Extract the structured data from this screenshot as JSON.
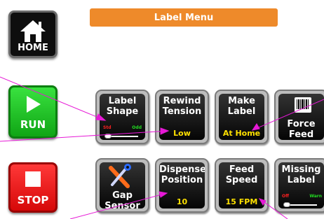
{
  "header": {
    "title": "Label Menu",
    "color": "#ee8a2a"
  },
  "side_buttons": {
    "home": {
      "label": "HOME",
      "icon": "house-icon"
    },
    "run": {
      "label": "RUN",
      "icon": "play-icon",
      "color": "#1cc022"
    },
    "stop": {
      "label": "STOP",
      "icon": "stop-icon",
      "color": "#ee1a1a"
    }
  },
  "tiles": [
    {
      "id": "label-shape",
      "label": [
        "Label",
        "Shape"
      ],
      "value": "",
      "toggle": {
        "left": "Std",
        "right": "Odd",
        "position": "left"
      }
    },
    {
      "id": "rewind-tension",
      "label": [
        "Rewind",
        "Tension"
      ],
      "value": "Low"
    },
    {
      "id": "make-label",
      "label": [
        "Make",
        "Label"
      ],
      "value": "At Home"
    },
    {
      "id": "force-feed",
      "label": [
        "Force",
        "Feed"
      ],
      "value": "",
      "icon": "barcode-label-icon"
    },
    {
      "id": "gap-sensor",
      "label": [
        "Gap",
        "Sensor"
      ],
      "value": "",
      "icon": "tools-icon"
    },
    {
      "id": "dispense-position",
      "label": [
        "Dispense",
        "Position"
      ],
      "value": "10"
    },
    {
      "id": "feed-speed",
      "label": [
        "Feed",
        "Speed"
      ],
      "value": "15 FPM"
    },
    {
      "id": "missing-label",
      "label": [
        "Missing",
        "Label"
      ],
      "value": "",
      "toggle": {
        "left": "Off",
        "right": "Warn",
        "position": "left"
      }
    }
  ],
  "callout_color": "#e619d6"
}
